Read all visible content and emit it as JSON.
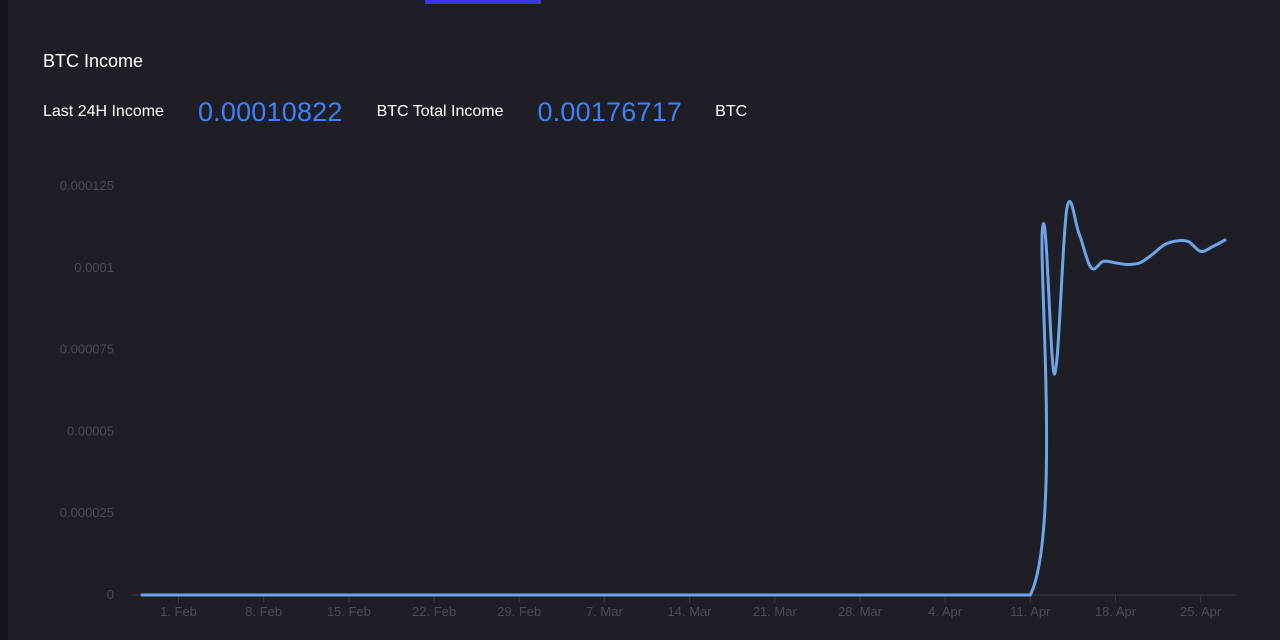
{
  "header": {
    "title": "BTC Income",
    "last24h_label": "Last 24H Income",
    "last24h_value": "0.00010822",
    "total_label": "BTC Total Income",
    "total_value": "0.00176717",
    "unit": "BTC"
  },
  "colors": {
    "accent": "#3b82f6",
    "line": "#6aa6e8",
    "tab_indicator": "#3a35e6"
  },
  "chart_data": {
    "type": "line",
    "title": "BTC Income",
    "xlabel": "",
    "ylabel": "",
    "ylim": [
      0,
      0.000125
    ],
    "grid": false,
    "y_ticks": [
      0,
      2.5e-05,
      5e-05,
      7.5e-05,
      0.0001,
      0.000125
    ],
    "y_tick_labels": [
      "0",
      "0.000025",
      "0.00005",
      "0.000075",
      "0.0001",
      "0.000125"
    ],
    "x_ticks": [
      "2024-02-01",
      "2024-02-08",
      "2024-02-15",
      "2024-02-22",
      "2024-02-29",
      "2024-03-07",
      "2024-03-14",
      "2024-03-21",
      "2024-03-28",
      "2024-04-04",
      "2024-04-11",
      "2024-04-18",
      "2024-04-25"
    ],
    "x_tick_labels": [
      "1. Feb",
      "8. Feb",
      "15. Feb",
      "22. Feb",
      "29. Feb",
      "7. Mar",
      "14. Mar",
      "21. Mar",
      "28. Mar",
      "4. Apr",
      "11. Apr",
      "18. Apr",
      "25. Apr"
    ],
    "series": [
      {
        "x": [
          "2024-01-29",
          "2024-02-15",
          "2024-03-07",
          "2024-03-28",
          "2024-04-11",
          "2024-04-12",
          "2024-04-13",
          "2024-04-14",
          "2024-04-15",
          "2024-04-16",
          "2024-04-17",
          "2024-04-18",
          "2024-04-19",
          "2024-04-20",
          "2024-04-21",
          "2024-04-22",
          "2024-04-23",
          "2024-04-24",
          "2024-04-25",
          "2024-04-26",
          "2024-04-27"
        ],
        "values": [
          0,
          0,
          0,
          0,
          0,
          0.000112,
          6.75e-05,
          0.000118,
          0.0001105,
          0.0001,
          0.000102,
          0.0001015,
          0.000101,
          0.0001015,
          0.000104,
          0.000107,
          0.0001082,
          0.000108,
          0.000105,
          0.0001065,
          0.0001085
        ]
      }
    ]
  }
}
